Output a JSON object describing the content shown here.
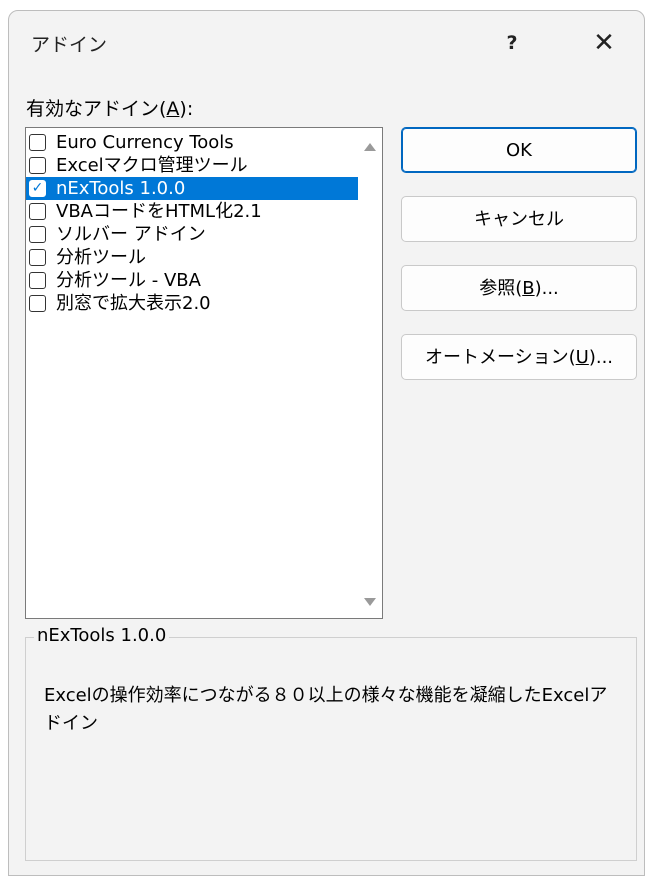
{
  "dialog": {
    "title": "アドイン",
    "help_label": "?",
    "close_label": "✕"
  },
  "list": {
    "label_prefix": "有効なアドイン(",
    "label_accel": "A",
    "label_suffix": "):",
    "items": [
      {
        "label": "Euro Currency Tools",
        "checked": false,
        "selected": false
      },
      {
        "label": "Excelマクロ管理ツール",
        "checked": false,
        "selected": false
      },
      {
        "label": "nExTools 1.0.0",
        "checked": true,
        "selected": true
      },
      {
        "label": "VBAコードをHTML化2.1",
        "checked": false,
        "selected": false
      },
      {
        "label": "ソルバー アドイン",
        "checked": false,
        "selected": false
      },
      {
        "label": "分析ツール",
        "checked": false,
        "selected": false
      },
      {
        "label": "分析ツール - VBA",
        "checked": false,
        "selected": false
      },
      {
        "label": "別窓で拡大表示2.0",
        "checked": false,
        "selected": false
      }
    ]
  },
  "buttons": {
    "ok": "OK",
    "cancel": "キャンセル",
    "browse_prefix": "参照(",
    "browse_accel": "B",
    "browse_suffix": ")...",
    "automation_prefix": "オートメーション(",
    "automation_accel": "U",
    "automation_suffix": ")..."
  },
  "details": {
    "name": "nExTools 1.0.0",
    "description": "Excelの操作効率につながる８０以上の様々な機能を凝縮したExcelアドイン"
  },
  "colors": {
    "selection": "#0078d7",
    "dialog_bg": "#f3f3f3",
    "default_border": "#0067c0"
  }
}
